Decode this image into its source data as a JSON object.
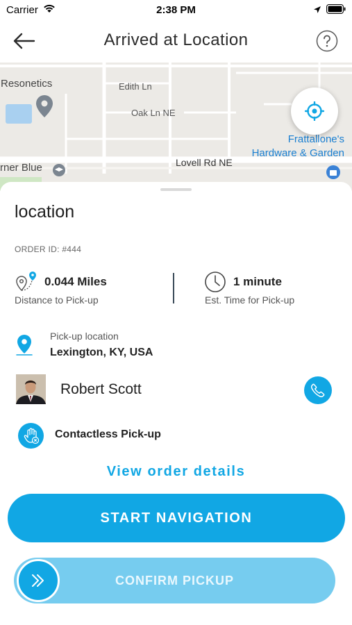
{
  "status_bar": {
    "carrier": "Carrier",
    "time": "2:38 PM"
  },
  "nav": {
    "title": "Arrived at Location",
    "back_icon": "arrow-left-icon",
    "help_icon": "question-circle-icon"
  },
  "map": {
    "labels": {
      "resonetics": "Resonetics",
      "edith": "Edith Ln",
      "oak": "Oak Ln NE",
      "lovell": "Lovell Rd NE",
      "corner_blue": "rner Blue",
      "poi_line1": "Frattallone's",
      "poi_line2": "Hardware & Garden"
    },
    "locate_icon": "crosshair-icon"
  },
  "order": {
    "title": "location",
    "order_id": "ORDER ID: #444",
    "distance_value": "0.044 Miles",
    "distance_label": "Distance to Pick-up",
    "time_value": "1 minute",
    "time_label": "Est. Time for Pick-up",
    "pickup_label": "Pick-up location",
    "pickup_value": "Lexington, KY, USA",
    "customer_name": "Robert Scott",
    "contactless_label": "Contactless Pick-up",
    "view_details": "View order details"
  },
  "actions": {
    "start_navigation": "START NAVIGATION",
    "confirm_pickup": "CONFIRM PICKUP"
  },
  "colors": {
    "accent": "#11a7e4",
    "accent_light": "#76ccef",
    "map_bg": "#eceae6"
  }
}
